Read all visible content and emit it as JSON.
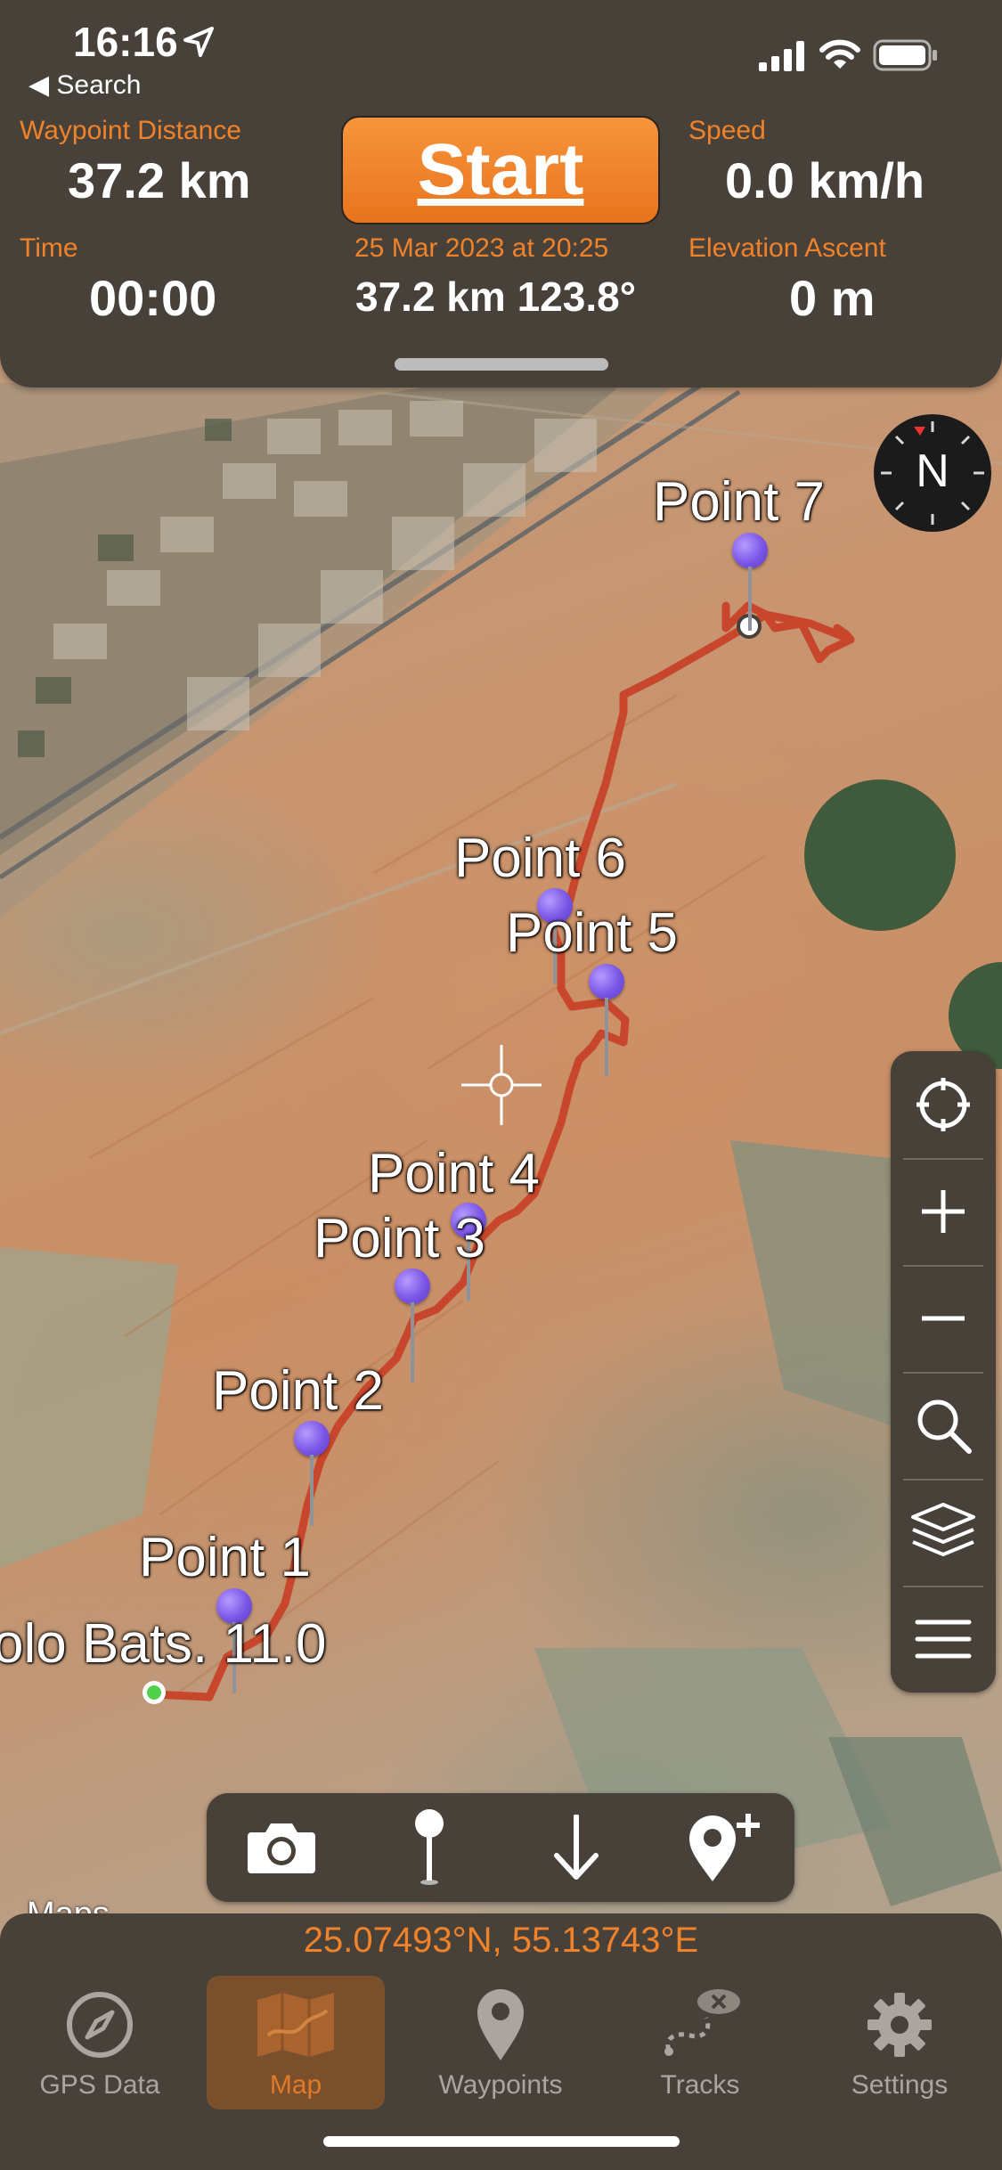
{
  "status_bar": {
    "time": "16:16",
    "back_label": "◀ Search"
  },
  "stats": {
    "waypoint_distance": {
      "label": "Waypoint Distance",
      "value": "37.2 km"
    },
    "speed": {
      "label": "Speed",
      "value": "0.0 km/h"
    },
    "time": {
      "label": "Time",
      "value": "00:00"
    },
    "elevation_ascent": {
      "label": "Elevation Ascent",
      "value": "0 m"
    },
    "start_label": "Start",
    "date": "25 Mar 2023 at 20:25",
    "distance_bearing": "37.2 km 123.8°"
  },
  "map": {
    "compass_label": "N",
    "waypoints": [
      "Point 7",
      "Point 6",
      "Point 5",
      "Point 4",
      "Point 3",
      "Point 2",
      "Point 1"
    ],
    "start_label": "olo Bats. 11.0",
    "attribution": "Maps"
  },
  "map_controls": [
    "locate-icon",
    "zoom-in-icon",
    "zoom-out-icon",
    "search-icon",
    "layers-icon",
    "menu-icon"
  ],
  "actions": [
    "camera-icon",
    "pin-icon",
    "download-icon",
    "add-waypoint-icon"
  ],
  "coordinates": "25.07493°N, 55.13743°E",
  "tabs": [
    {
      "label": "GPS Data",
      "icon": "compass-icon"
    },
    {
      "label": "Map",
      "icon": "map-icon",
      "active": true
    },
    {
      "label": "Waypoints",
      "icon": "waypoint-icon"
    },
    {
      "label": "Tracks",
      "icon": "tracks-icon"
    },
    {
      "label": "Settings",
      "icon": "gear-icon"
    }
  ],
  "colors": {
    "accent": "#f0832a",
    "panel": "#47413a",
    "track": "#c8472c",
    "pin": "#7b55e6"
  }
}
